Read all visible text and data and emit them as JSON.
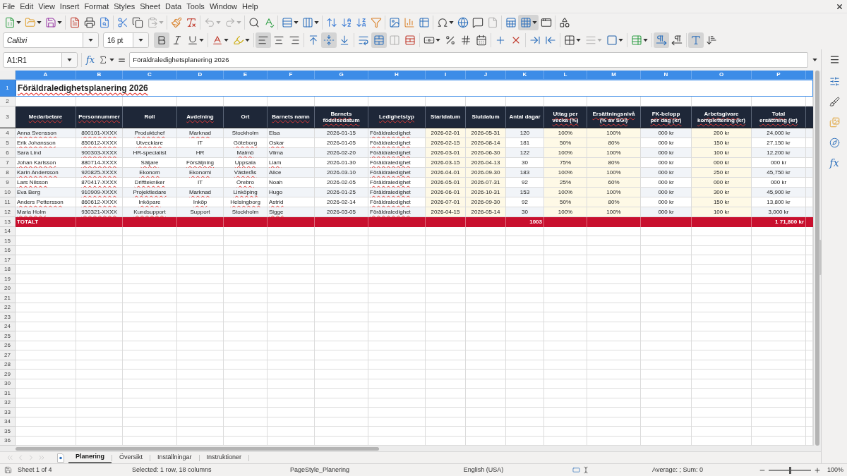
{
  "menu_bar": [
    "File",
    "Edit",
    "View",
    "Insert",
    "Format",
    "Styles",
    "Sheet",
    "Data",
    "Tools",
    "Window",
    "Help"
  ],
  "standard_toolbar": [
    {
      "on": false,
      "disabled": false
    },
    {
      "on": false,
      "disabled": false
    },
    {
      "on": false,
      "disabled": false
    },
    {
      "on": false,
      "disabled": false
    },
    {
      "on": false,
      "disabled": false
    },
    {
      "on": false,
      "disabled": false
    },
    {
      "on": false,
      "disabled": false
    },
    {
      "on": false,
      "disabled": false
    },
    {
      "on": false,
      "disabled": true
    },
    {
      "on": false,
      "disabled": false
    },
    {
      "on": false,
      "disabled": false
    },
    {
      "on": false,
      "disabled": true
    },
    {
      "on": false,
      "disabled": true
    },
    {
      "on": false,
      "disabled": false
    },
    {
      "on": false,
      "disabled": false
    },
    {
      "on": false,
      "disabled": false
    },
    {
      "on": false,
      "disabled": false
    },
    {
      "on": false,
      "disabled": false
    },
    {
      "on": false,
      "disabled": false
    },
    {
      "on": false,
      "disabled": false
    },
    {
      "on": false,
      "disabled": false
    },
    {
      "on": false,
      "disabled": false
    },
    {
      "on": false,
      "disabled": false
    },
    {
      "on": false,
      "disabled": false
    },
    {
      "on": false,
      "disabled": false
    },
    {
      "on": false,
      "disabled": false
    },
    {
      "on": false,
      "disabled": false
    },
    {
      "on": false,
      "disabled": true
    },
    {
      "on": false,
      "disabled": false
    },
    {
      "on": true,
      "disabled": false
    },
    {
      "on": false,
      "disabled": false
    },
    {
      "on": false,
      "disabled": false
    }
  ],
  "formatting_toolbar": {
    "font_name": "Calibri",
    "font_size": "16 pt",
    "buttons": [
      {
        "on": true,
        "disabled": false
      },
      {
        "on": false,
        "disabled": false
      },
      {
        "on": false,
        "disabled": false
      },
      {
        "on": false,
        "disabled": false
      },
      {
        "on": false,
        "disabled": false
      },
      {
        "on": true,
        "disabled": false
      },
      {
        "on": false,
        "disabled": false
      },
      {
        "on": false,
        "disabled": false
      },
      {
        "on": false,
        "disabled": false
      },
      {
        "on": true,
        "disabled": false
      },
      {
        "on": false,
        "disabled": false
      },
      {
        "on": false,
        "disabled": false
      },
      {
        "on": true,
        "disabled": false
      },
      {
        "on": false,
        "disabled": true
      },
      {
        "on": false,
        "disabled": false
      },
      {
        "on": false,
        "disabled": false
      },
      {
        "on": false,
        "disabled": false
      },
      {
        "on": false,
        "disabled": false
      },
      {
        "on": false,
        "disabled": false
      },
      {
        "on": false,
        "disabled": false
      },
      {
        "on": false,
        "disabled": false
      },
      {
        "on": false,
        "disabled": false
      },
      {
        "on": false,
        "disabled": false
      },
      {
        "on": false,
        "disabled": false
      },
      {
        "on": false,
        "disabled": true
      },
      {
        "on": false,
        "disabled": false
      },
      {
        "on": false,
        "disabled": false
      },
      {
        "on": true,
        "disabled": false
      },
      {
        "on": false,
        "disabled": false
      },
      {
        "on": true,
        "disabled": false
      },
      {
        "on": false,
        "disabled": false
      }
    ]
  },
  "formula_bar": {
    "name_box": "A1:R1",
    "function_wizard": "fx",
    "formula": "Föräldraledighetsplanering 2026"
  },
  "sheet": {
    "columns": [
      {
        "label": "A",
        "selected": true,
        "kind": "striped"
      },
      {
        "label": "B",
        "selected": true,
        "kind": "striped"
      },
      {
        "label": "C",
        "selected": true,
        "kind": "striped"
      },
      {
        "label": "D",
        "selected": true,
        "kind": "striped"
      },
      {
        "label": "E",
        "selected": true,
        "kind": "striped"
      },
      {
        "label": "F",
        "selected": true,
        "kind": "striped"
      },
      {
        "label": "G",
        "selected": true,
        "kind": "striped"
      },
      {
        "label": "H",
        "selected": true,
        "kind": "striped"
      },
      {
        "label": "I",
        "selected": true,
        "kind": "shaded"
      },
      {
        "label": "J",
        "selected": true,
        "kind": "shaded"
      },
      {
        "label": "K",
        "selected": true,
        "kind": "striped"
      },
      {
        "label": "L",
        "selected": true,
        "kind": "shaded"
      },
      {
        "label": "M",
        "selected": true,
        "kind": "shaded"
      },
      {
        "label": "N",
        "selected": true,
        "kind": "striped"
      },
      {
        "label": "O",
        "selected": true,
        "kind": "shaded"
      },
      {
        "label": "P",
        "selected": true,
        "kind": "striped"
      }
    ],
    "row_headers": [
      {
        "label": "1",
        "selected": true
      },
      {
        "label": "2",
        "selected": false
      },
      {
        "label": "3",
        "selected": false
      },
      {
        "label": "4",
        "selected": false
      },
      {
        "label": "5",
        "selected": false
      },
      {
        "label": "6",
        "selected": false
      },
      {
        "label": "7",
        "selected": false
      },
      {
        "label": "8",
        "selected": false
      },
      {
        "label": "9",
        "selected": false
      },
      {
        "label": "10",
        "selected": false
      },
      {
        "label": "11",
        "selected": false
      },
      {
        "label": "12",
        "selected": false
      },
      {
        "label": "13",
        "selected": false
      },
      {
        "label": "14",
        "selected": false
      },
      {
        "label": "15",
        "selected": false
      },
      {
        "label": "16",
        "selected": false
      },
      {
        "label": "17",
        "selected": false
      },
      {
        "label": "18",
        "selected": false
      },
      {
        "label": "19",
        "selected": false
      },
      {
        "label": "20",
        "selected": false
      },
      {
        "label": "21",
        "selected": false
      },
      {
        "label": "22",
        "selected": false
      },
      {
        "label": "23",
        "selected": false
      },
      {
        "label": "24",
        "selected": false
      },
      {
        "label": "25",
        "selected": false
      },
      {
        "label": "26",
        "selected": false
      },
      {
        "label": "27",
        "selected": false
      },
      {
        "label": "28",
        "selected": false
      },
      {
        "label": "29",
        "selected": false
      },
      {
        "label": "30",
        "selected": false
      },
      {
        "label": "31",
        "selected": false
      },
      {
        "label": "32",
        "selected": false
      },
      {
        "label": "33",
        "selected": false
      },
      {
        "label": "34",
        "selected": false
      },
      {
        "label": "35",
        "selected": false
      },
      {
        "label": "36",
        "selected": false
      }
    ],
    "title": {
      "text": "Föräldraledighetsplanering 2026",
      "misspelled": true
    },
    "header": [
      {
        "text": "Medarbetare",
        "misspelled": true
      },
      {
        "text": "Personnummer",
        "misspelled": true
      },
      {
        "text": "Roll",
        "misspelled": false
      },
      {
        "text": "Avdelning",
        "misspelled": true
      },
      {
        "text": "Ort",
        "misspelled": false
      },
      {
        "text": "Barnets namn",
        "misspelled": true
      },
      {
        "text": "Barnets födelsedatum",
        "misspelled": true
      },
      {
        "text": "Ledighetstyp",
        "misspelled": true
      },
      {
        "text": "Startdatum",
        "misspelled": false
      },
      {
        "text": "Slutdatum",
        "misspelled": false
      },
      {
        "text": "Antal dagar",
        "misspelled": false
      },
      {
        "text": "Uttag per vecka (%)",
        "misspelled": true
      },
      {
        "text": "Ersättningsnivå (% av SGI)",
        "misspelled": true
      },
      {
        "text": "FK-belopp per dag (kr)",
        "misspelled": true
      },
      {
        "text": "Arbetsgivare komplettering (kr)",
        "misspelled": true
      },
      {
        "text": "Total ersättning (kr)",
        "misspelled": true
      }
    ],
    "records": [
      {
        "cells": [
          {
            "text": "Anna Svensson",
            "misspelled": true
          },
          {
            "text": "800101-XXXX",
            "misspelled": true
          },
          {
            "text": "Produktchef",
            "misspelled": true
          },
          {
            "text": "Marknad",
            "misspelled": true
          },
          {
            "text": "Stockholm",
            "misspelled": false
          },
          {
            "text": "Elsa",
            "misspelled": false
          },
          {
            "text": "2026-01-15",
            "misspelled": false
          },
          {
            "text": "Föräldraledighet",
            "misspelled": true
          },
          {
            "text": "2026-02-01",
            "misspelled": false
          },
          {
            "text": "2026-05-31",
            "misspelled": false
          },
          {
            "text": "120",
            "misspelled": false
          },
          {
            "text": "100%",
            "misspelled": false
          },
          {
            "text": "100%",
            "misspelled": false
          },
          {
            "text": "000 kr",
            "misspelled": false
          },
          {
            "text": "200 kr",
            "misspelled": false
          },
          {
            "text": "24,000 kr",
            "misspelled": false
          }
        ]
      },
      {
        "cells": [
          {
            "text": "Erik Johansson",
            "misspelled": true
          },
          {
            "text": "850612-XXXX",
            "misspelled": true
          },
          {
            "text": "Utvecklare",
            "misspelled": true
          },
          {
            "text": "IT",
            "misspelled": false
          },
          {
            "text": "Göteborg",
            "misspelled": true
          },
          {
            "text": "Oskar",
            "misspelled": true
          },
          {
            "text": "2026-01-05",
            "misspelled": false
          },
          {
            "text": "Föräldraledighet",
            "misspelled": true
          },
          {
            "text": "2026-02-15",
            "misspelled": false
          },
          {
            "text": "2026-08-14",
            "misspelled": false
          },
          {
            "text": "181",
            "misspelled": false
          },
          {
            "text": "50%",
            "misspelled": false
          },
          {
            "text": "80%",
            "misspelled": false
          },
          {
            "text": "000 kr",
            "misspelled": false
          },
          {
            "text": "150 kr",
            "misspelled": false
          },
          {
            "text": "27,150 kr",
            "misspelled": false
          }
        ]
      },
      {
        "cells": [
          {
            "text": "Sara Lind",
            "misspelled": false
          },
          {
            "text": "900303-XXXX",
            "misspelled": true
          },
          {
            "text": "HR-specialist",
            "misspelled": false
          },
          {
            "text": "HR",
            "misspelled": false
          },
          {
            "text": "Malmö",
            "misspelled": true
          },
          {
            "text": "Vilma",
            "misspelled": false
          },
          {
            "text": "2026-02-20",
            "misspelled": false
          },
          {
            "text": "Föräldraledighet",
            "misspelled": true
          },
          {
            "text": "2026-03-01",
            "misspelled": false
          },
          {
            "text": "2026-06-30",
            "misspelled": false
          },
          {
            "text": "122",
            "misspelled": false
          },
          {
            "text": "100%",
            "misspelled": false
          },
          {
            "text": "100%",
            "misspelled": false
          },
          {
            "text": "000 kr",
            "misspelled": false
          },
          {
            "text": "100 kr",
            "misspelled": false
          },
          {
            "text": "12,200 kr",
            "misspelled": false
          }
        ]
      },
      {
        "cells": [
          {
            "text": "Johan Karlsson",
            "misspelled": true
          },
          {
            "text": "880714-XXXX",
            "misspelled": true
          },
          {
            "text": "Säljare",
            "misspelled": true
          },
          {
            "text": "Försäljning",
            "misspelled": true
          },
          {
            "text": "Uppsala",
            "misspelled": true
          },
          {
            "text": "Liam",
            "misspelled": true
          },
          {
            "text": "2026-01-30",
            "misspelled": false
          },
          {
            "text": "Föräldraledighet",
            "misspelled": true
          },
          {
            "text": "2026-03-15",
            "misspelled": false
          },
          {
            "text": "2026-04-13",
            "misspelled": false
          },
          {
            "text": "30",
            "misspelled": false
          },
          {
            "text": "75%",
            "misspelled": false
          },
          {
            "text": "80%",
            "misspelled": false
          },
          {
            "text": "000 kr",
            "misspelled": false
          },
          {
            "text": "000 kr",
            "misspelled": false
          },
          {
            "text": "000 kr",
            "misspelled": false
          }
        ]
      },
      {
        "cells": [
          {
            "text": "Karin Andersson",
            "misspelled": true
          },
          {
            "text": "920825-XXXX",
            "misspelled": true
          },
          {
            "text": "Ekonom",
            "misspelled": true
          },
          {
            "text": "Ekonomi",
            "misspelled": true
          },
          {
            "text": "Västerås",
            "misspelled": true
          },
          {
            "text": "Alice",
            "misspelled": false
          },
          {
            "text": "2026-03-10",
            "misspelled": false
          },
          {
            "text": "Föräldraledighet",
            "misspelled": true
          },
          {
            "text": "2026-04-01",
            "misspelled": false
          },
          {
            "text": "2026-09-30",
            "misspelled": false
          },
          {
            "text": "183",
            "misspelled": false
          },
          {
            "text": "100%",
            "misspelled": false
          },
          {
            "text": "100%",
            "misspelled": false
          },
          {
            "text": "000 kr",
            "misspelled": false
          },
          {
            "text": "250 kr",
            "misspelled": false
          },
          {
            "text": "45,750 kr",
            "misspelled": false
          }
        ]
      },
      {
        "cells": [
          {
            "text": "Lars Nilsson",
            "misspelled": true
          },
          {
            "text": "870417-XXXX",
            "misspelled": true
          },
          {
            "text": "Drifttekniker",
            "misspelled": true
          },
          {
            "text": "IT",
            "misspelled": false
          },
          {
            "text": "Örebro",
            "misspelled": true
          },
          {
            "text": "Noah",
            "misspelled": false
          },
          {
            "text": "2026-02-05",
            "misspelled": false
          },
          {
            "text": "Föräldraledighet",
            "misspelled": true
          },
          {
            "text": "2026-05-01",
            "misspelled": false
          },
          {
            "text": "2026-07-31",
            "misspelled": false
          },
          {
            "text": "92",
            "misspelled": false
          },
          {
            "text": "25%",
            "misspelled": false
          },
          {
            "text": "60%",
            "misspelled": false
          },
          {
            "text": "000 kr",
            "misspelled": false
          },
          {
            "text": "000 kr",
            "misspelled": false
          },
          {
            "text": "000 kr",
            "misspelled": false
          }
        ]
      },
      {
        "cells": [
          {
            "text": "Eva Berg",
            "misspelled": false
          },
          {
            "text": "910909-XXXX",
            "misspelled": true
          },
          {
            "text": "Projektledare",
            "misspelled": true
          },
          {
            "text": "Marknad",
            "misspelled": true
          },
          {
            "text": "Linköping",
            "misspelled": true
          },
          {
            "text": "Hugo",
            "misspelled": false
          },
          {
            "text": "2026-01-25",
            "misspelled": false
          },
          {
            "text": "Föräldraledighet",
            "misspelled": true
          },
          {
            "text": "2026-06-01",
            "misspelled": false
          },
          {
            "text": "2026-10-31",
            "misspelled": false
          },
          {
            "text": "153",
            "misspelled": false
          },
          {
            "text": "100%",
            "misspelled": false
          },
          {
            "text": "100%",
            "misspelled": false
          },
          {
            "text": "000 kr",
            "misspelled": false
          },
          {
            "text": "300 kr",
            "misspelled": false
          },
          {
            "text": "45,900 kr",
            "misspelled": false
          }
        ]
      },
      {
        "cells": [
          {
            "text": "Anders Pettersson",
            "misspelled": true
          },
          {
            "text": "860612-XXXX",
            "misspelled": true
          },
          {
            "text": "Inköpare",
            "misspelled": true
          },
          {
            "text": "Inköp",
            "misspelled": true
          },
          {
            "text": "Helsingborg",
            "misspelled": true
          },
          {
            "text": "Astrid",
            "misspelled": true
          },
          {
            "text": "2026-02-14",
            "misspelled": false
          },
          {
            "text": "Föräldraledighet",
            "misspelled": true
          },
          {
            "text": "2026-07-01",
            "misspelled": false
          },
          {
            "text": "2026-09-30",
            "misspelled": false
          },
          {
            "text": "92",
            "misspelled": false
          },
          {
            "text": "50%",
            "misspelled": false
          },
          {
            "text": "80%",
            "misspelled": false
          },
          {
            "text": "000 kr",
            "misspelled": false
          },
          {
            "text": "150 kr",
            "misspelled": false
          },
          {
            "text": "13,800 kr",
            "misspelled": false
          }
        ]
      },
      {
        "cells": [
          {
            "text": "Maria Holm",
            "misspelled": true
          },
          {
            "text": "930321-XXXX",
            "misspelled": true
          },
          {
            "text": "Kundsupport",
            "misspelled": true
          },
          {
            "text": "Support",
            "misspelled": false
          },
          {
            "text": "Stockholm",
            "misspelled": false
          },
          {
            "text": "Sigge",
            "misspelled": true
          },
          {
            "text": "2026-03-05",
            "misspelled": false
          },
          {
            "text": "Föräldraledighet",
            "misspelled": true
          },
          {
            "text": "2026-04-15",
            "misspelled": false
          },
          {
            "text": "2026-05-14",
            "misspelled": false
          },
          {
            "text": "30",
            "misspelled": false
          },
          {
            "text": "100%",
            "misspelled": false
          },
          {
            "text": "100%",
            "misspelled": false
          },
          {
            "text": "000 kr",
            "misspelled": false
          },
          {
            "text": "100 kr",
            "misspelled": false
          },
          {
            "text": "3,000 kr",
            "misspelled": false
          }
        ]
      }
    ],
    "total": {
      "label": "TOTALT",
      "antal_dagar": "1003",
      "total_ersattning": "1 71,800 kr"
    }
  },
  "sheet_tabs": {
    "navigation": [
      {
        "disabled": true
      },
      {
        "disabled": true
      },
      {
        "disabled": true
      },
      {
        "disabled": true
      }
    ],
    "tabs": [
      {
        "label": "Planering",
        "selected": true
      },
      {
        "label": "Översikt",
        "selected": false
      },
      {
        "label": "Inställningar",
        "selected": false
      },
      {
        "label": "Instruktioner",
        "selected": false
      }
    ]
  },
  "sidebar": {
    "functions": "fx"
  },
  "status_bar": {
    "sheet": "Sheet 1 of 4",
    "selection": "Selected: 1 row, 18 columns",
    "page_style": "PageStyle_Planering",
    "language": "English (USA)",
    "statistics": "Average: ; Sum: 0",
    "zoom_slider": {
      "level": 0.5
    },
    "zoom": "100%"
  }
}
